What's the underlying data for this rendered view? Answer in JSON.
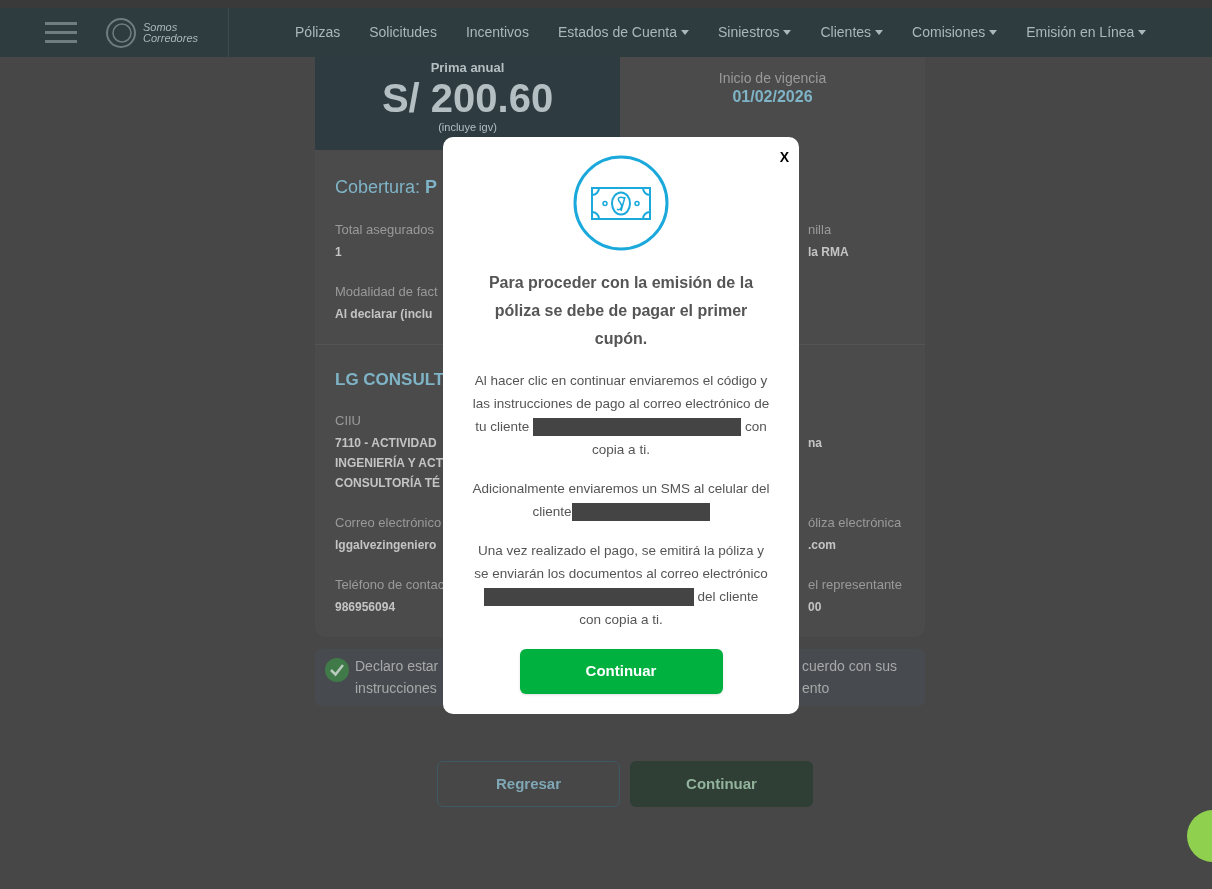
{
  "nav": {
    "logo_lines": [
      "Somos",
      "Corredores"
    ],
    "items": [
      {
        "label": "Pólizas",
        "dropdown": false
      },
      {
        "label": "Solicitudes",
        "dropdown": false
      },
      {
        "label": "Incentivos",
        "dropdown": false
      },
      {
        "label": "Estados de Cuenta",
        "dropdown": true
      },
      {
        "label": "Siniestros",
        "dropdown": true
      },
      {
        "label": "Clientes",
        "dropdown": true
      },
      {
        "label": "Comisiones",
        "dropdown": true
      },
      {
        "label": "Emisión en Línea",
        "dropdown": true
      }
    ]
  },
  "summary": {
    "premium_label": "Prima anual",
    "premium": "S/ 200.60",
    "premium_note": "(incluye igv)",
    "start_label": "Inicio de vigencia",
    "start_date": "01/02/2026"
  },
  "coverage_title": "Cobertura: **P**",
  "policy_rows": [
    {
      "left_label": "Total asegurados",
      "left_value": [
        "1"
      ],
      "right_label": "nilla",
      "right_value": "la RMA"
    },
    {
      "left_label": "Modalidad de fact",
      "left_value": [
        "Al declarar (inclu"
      ]
    }
  ],
  "company": "LG CONSULT",
  "company_rows": [
    {
      "left_label": "CIIU",
      "left_value": [
        "7110 - ACTIVIDAD",
        "INGENIERÍA Y ACT",
        "CONSULTORÍA TÉ"
      ],
      "right_value": "na"
    },
    {
      "left_label": "Correo electrónico",
      "left_value": [
        "lggalvezingeniero"
      ],
      "right_label": "óliza electrónica",
      "right_value": ".com"
    },
    {
      "left_label": "Teléfono de contac",
      "left_value": [
        "986956094"
      ],
      "right_label": "el representante",
      "right_value": "00"
    }
  ],
  "declaration": {
    "checked": true,
    "left_lines": [
      "Declaro estar",
      "instrucciones"
    ],
    "right_lines": [
      "cuerdo con sus",
      "ento"
    ]
  },
  "buttons": {
    "back": "Regresar",
    "next": "Continuar"
  },
  "modal": {
    "close": "X",
    "title": "Para proceder con la emisión de la póliza se debe de pagar el primer cupón.",
    "paragraphs": [
      [
        {
          "kind": "text",
          "text": "Al hacer clic en continuar enviaremos el código y las instrucciones de pago al correo electrónico de tu cliente "
        },
        {
          "kind": "redacted"
        },
        {
          "kind": "text",
          "text": " con copia a ti."
        }
      ],
      [
        {
          "kind": "text",
          "text": "Adicionalmente enviaremos un SMS al celular del cliente"
        },
        {
          "kind": "redacted"
        }
      ],
      [
        {
          "kind": "text",
          "text": "Una vez realizado el pago, se emitirá la póliza y se enviarán los documentos al correo electrónico "
        },
        {
          "kind": "redacted"
        },
        {
          "kind": "text",
          "text": " del cliente con copia a ti."
        }
      ]
    ],
    "button": "Continuar"
  }
}
